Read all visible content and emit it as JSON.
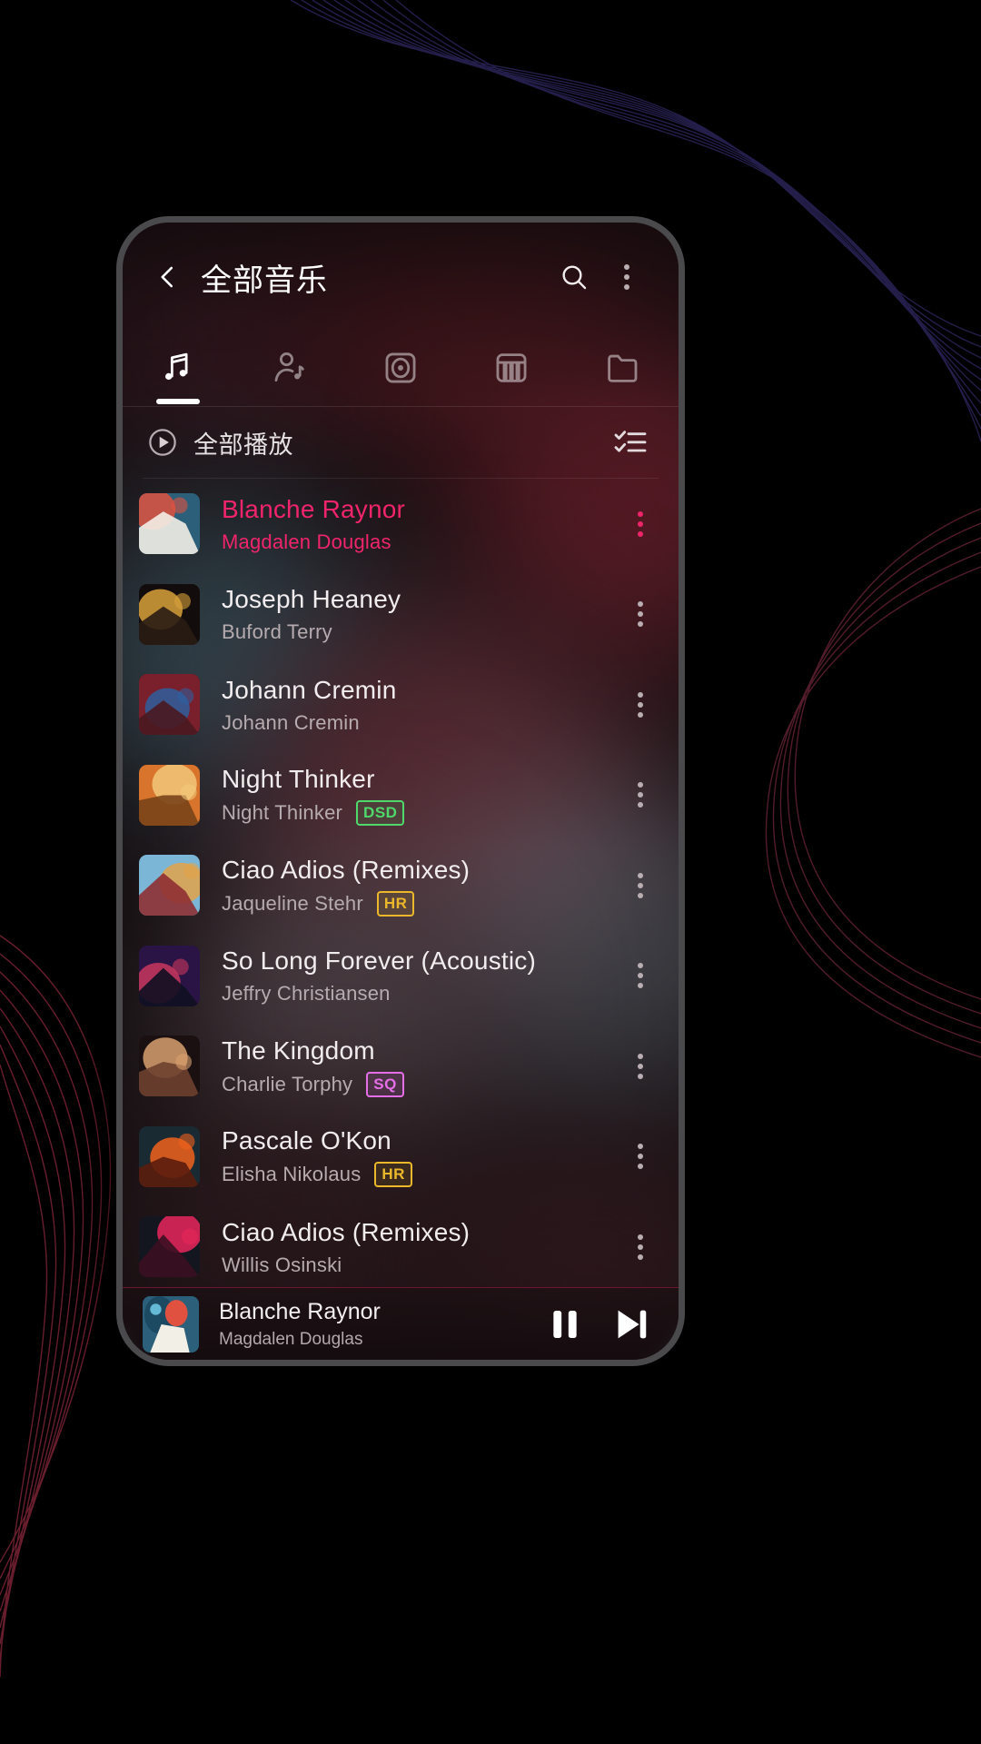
{
  "header": {
    "title": "全部音乐",
    "back_icon": "chevron-left-icon",
    "search_icon": "search-icon",
    "overflow_icon": "more-vertical-icon"
  },
  "tabs": [
    {
      "key": "songs",
      "icon": "music-note-icon",
      "active": true
    },
    {
      "key": "artists",
      "icon": "artist-icon",
      "active": false
    },
    {
      "key": "albums",
      "icon": "album-disc-icon",
      "active": false
    },
    {
      "key": "genres",
      "icon": "piano-keys-icon",
      "active": false
    },
    {
      "key": "folders",
      "icon": "folder-icon",
      "active": false
    }
  ],
  "playall": {
    "label": "全部播放",
    "play_icon": "play-circle-icon",
    "select_icon": "checklist-icon"
  },
  "colors": {
    "accent": "#f0246a",
    "badge_dsd": "#4fd96a",
    "badge_hr": "#eab82a",
    "badge_sq": "#e56fe8",
    "text_primary": "#f1ecee",
    "text_secondary": "#b6abaf"
  },
  "songs": [
    {
      "title": "Blanche Raynor",
      "artist": "Magdalen Douglas",
      "badge": "",
      "playing": true,
      "c1": "#2b5f7a",
      "c2": "#e0523f",
      "c3": "#f2efe6"
    },
    {
      "title": "Joseph Heaney",
      "artist": "Buford Terry",
      "badge": "",
      "playing": false,
      "c1": "#120d0c",
      "c2": "#d9a23c",
      "c3": "#2a1c14"
    },
    {
      "title": "Johann Cremin",
      "artist": "Johann Cremin",
      "badge": "",
      "playing": false,
      "c1": "#7a1f2c",
      "c2": "#2f5f9e",
      "c3": "#4a1820"
    },
    {
      "title": "Night Thinker",
      "artist": "Night Thinker",
      "badge": "DSD",
      "playing": false,
      "c1": "#d8742c",
      "c2": "#f2c87a",
      "c3": "#7a4418"
    },
    {
      "title": "Ciao Adios (Remixes)",
      "artist": "Jaqueline Stehr",
      "badge": "HR",
      "playing": false,
      "c1": "#7bb6d6",
      "c2": "#e2a349",
      "c3": "#8e2f33"
    },
    {
      "title": "So Long Forever (Acoustic)",
      "artist": "Jeffry Christiansen",
      "badge": "",
      "playing": false,
      "c1": "#2a1445",
      "c2": "#c8365e",
      "c3": "#101020"
    },
    {
      "title": "The Kingdom",
      "artist": "Charlie Torphy",
      "badge": "SQ",
      "playing": false,
      "c1": "#1a1012",
      "c2": "#d8a06e",
      "c3": "#6e4030"
    },
    {
      "title": "Pascale O'Kon",
      "artist": "Elisha Nikolaus",
      "badge": "HR",
      "playing": false,
      "c1": "#1a2a33",
      "c2": "#f0621c",
      "c3": "#5a1c0c"
    },
    {
      "title": "Ciao Adios (Remixes)",
      "artist": "Willis Osinski",
      "badge": "",
      "playing": false,
      "c1": "#14161f",
      "c2": "#e8265c",
      "c3": "#3a1020"
    }
  ],
  "player": {
    "title": "Blanche Raynor",
    "artist": "Magdalen Douglas",
    "pause_icon": "pause-icon",
    "next_icon": "skip-next-icon"
  }
}
